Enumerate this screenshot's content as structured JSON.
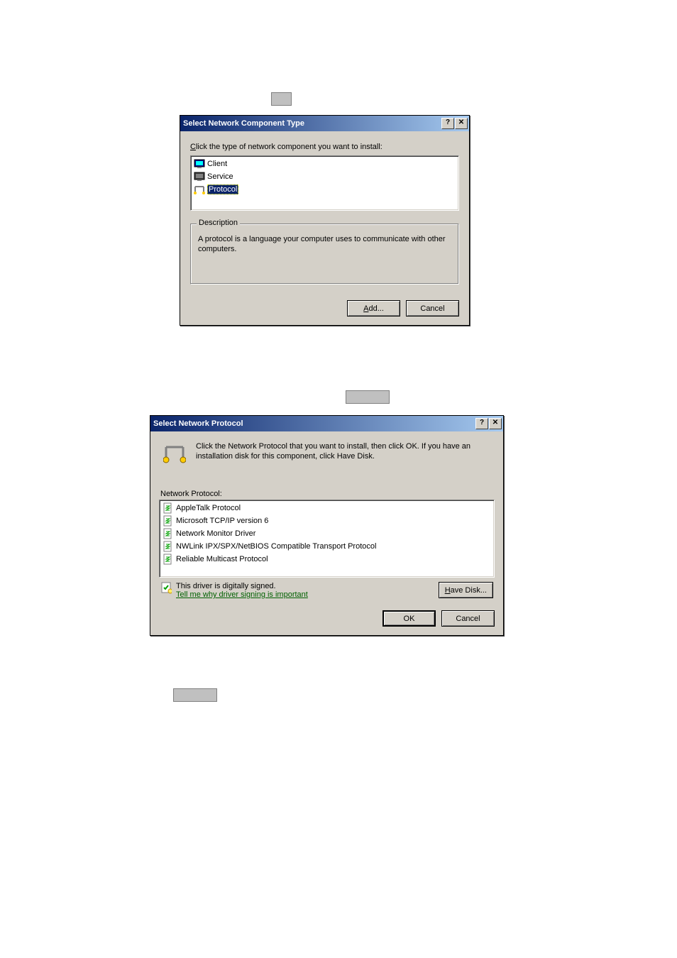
{
  "dialog1": {
    "title": "Select Network Component Type",
    "buttons": {
      "help": "?",
      "close": "✕"
    },
    "instruction": "Click the type of network component you want to install:",
    "items": [
      {
        "name": "client",
        "label": "Client",
        "selected": false
      },
      {
        "name": "service",
        "label": "Service",
        "selected": false
      },
      {
        "name": "protocol",
        "label": "Protocol",
        "selected": true
      }
    ],
    "description_legend": "Description",
    "description_text": "A protocol is a language your computer uses to communicate with other computers.",
    "add_label": "Add...",
    "cancel_label": "Cancel"
  },
  "dialog2": {
    "title": "Select Network Protocol",
    "buttons": {
      "help": "?",
      "close": "✕"
    },
    "intro": "Click the Network Protocol that you want to install, then click OK. If you have an installation disk for this component, click Have Disk.",
    "list_label": "Network Protocol:",
    "protocols": [
      "AppleTalk Protocol",
      "Microsoft TCP/IP version 6",
      "Network Monitor Driver",
      "NWLink IPX/SPX/NetBIOS Compatible Transport Protocol",
      "Reliable Multicast Protocol"
    ],
    "signed_text": "This driver is digitally signed.",
    "signed_link": "Tell me why driver signing is important",
    "have_disk_label": "Have Disk...",
    "ok_label": "OK",
    "cancel_label": "Cancel"
  }
}
